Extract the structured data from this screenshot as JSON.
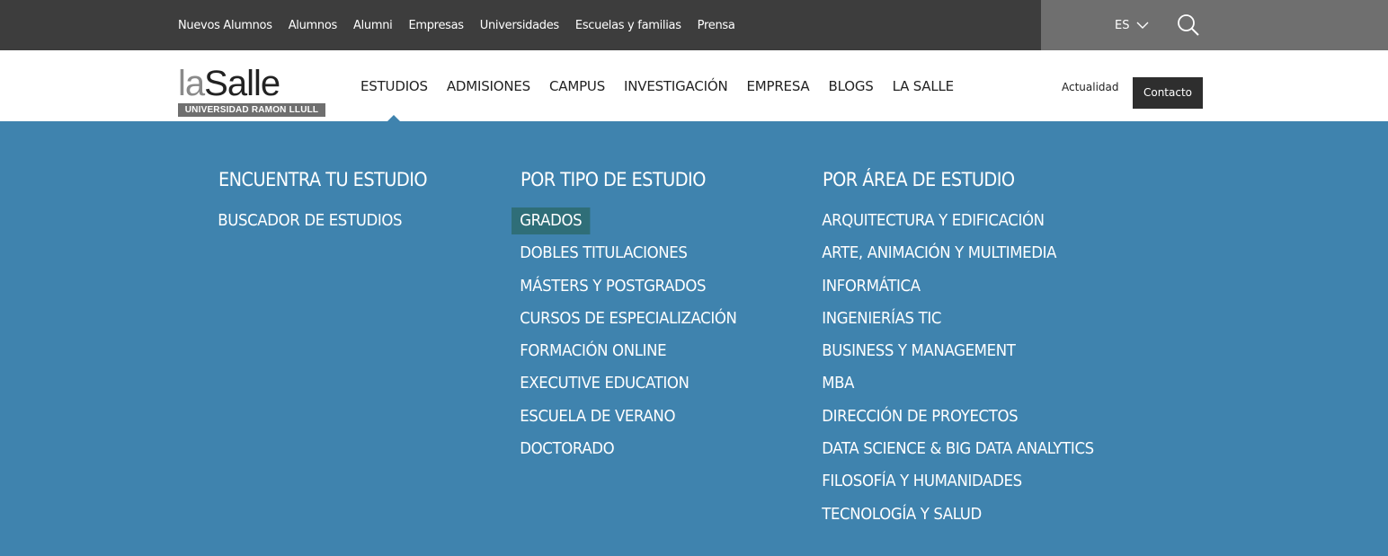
{
  "topbar": {
    "links": [
      "Nuevos Alumnos",
      "Alumnos",
      "Alumni",
      "Empresas",
      "Universidades",
      "Escuelas y familias",
      "Prensa"
    ],
    "language": "ES",
    "search_icon": "search-icon",
    "colors": {
      "left_bg": "#3d3d3d",
      "right_bg": "#6f6f6f"
    }
  },
  "header": {
    "logo": {
      "word_la": "la",
      "word_salle": "Salle",
      "subtitle": "UNIVERSIDAD RAMON LLULL"
    },
    "nav": [
      "ESTUDIOS",
      "ADMISIONES",
      "CAMPUS",
      "INVESTIGACIÓN",
      "EMPRESA",
      "BLOGS",
      "LA SALLE"
    ],
    "active_nav": "ESTUDIOS",
    "actualidad": "Actualidad",
    "contacto": "Contacto"
  },
  "mega_menu": {
    "background": "#3f83ae",
    "highlight": "#2f6e78",
    "columns": [
      {
        "title": "ENCUENTRA TU ESTUDIO",
        "items": [
          "BUSCADOR DE ESTUDIOS"
        ]
      },
      {
        "title": "POR TIPO DE ESTUDIO",
        "items": [
          "GRADOS",
          "DOBLES TITULACIONES",
          "MÁSTERS Y POSTGRADOS",
          "CURSOS DE ESPECIALIZACIÓN",
          "FORMACIÓN ONLINE",
          "EXECUTIVE EDUCATION",
          "ESCUELA DE VERANO",
          "DOCTORADO"
        ],
        "selected": "GRADOS"
      },
      {
        "title": "POR ÁREA DE ESTUDIO",
        "items": [
          "ARQUITECTURA Y EDIFICACIÓN",
          "ARTE, ANIMACIÓN Y MULTIMEDIA",
          "INFORMÁTICA",
          "INGENIERÍAS TIC",
          "BUSINESS Y MANAGEMENT",
          "MBA",
          "DIRECCIÓN DE PROYECTOS",
          "DATA SCIENCE & BIG DATA ANALYTICS",
          "FILOSOFÍA Y HUMANIDADES",
          "TECNOLOGÍA Y SALUD"
        ]
      }
    ]
  }
}
